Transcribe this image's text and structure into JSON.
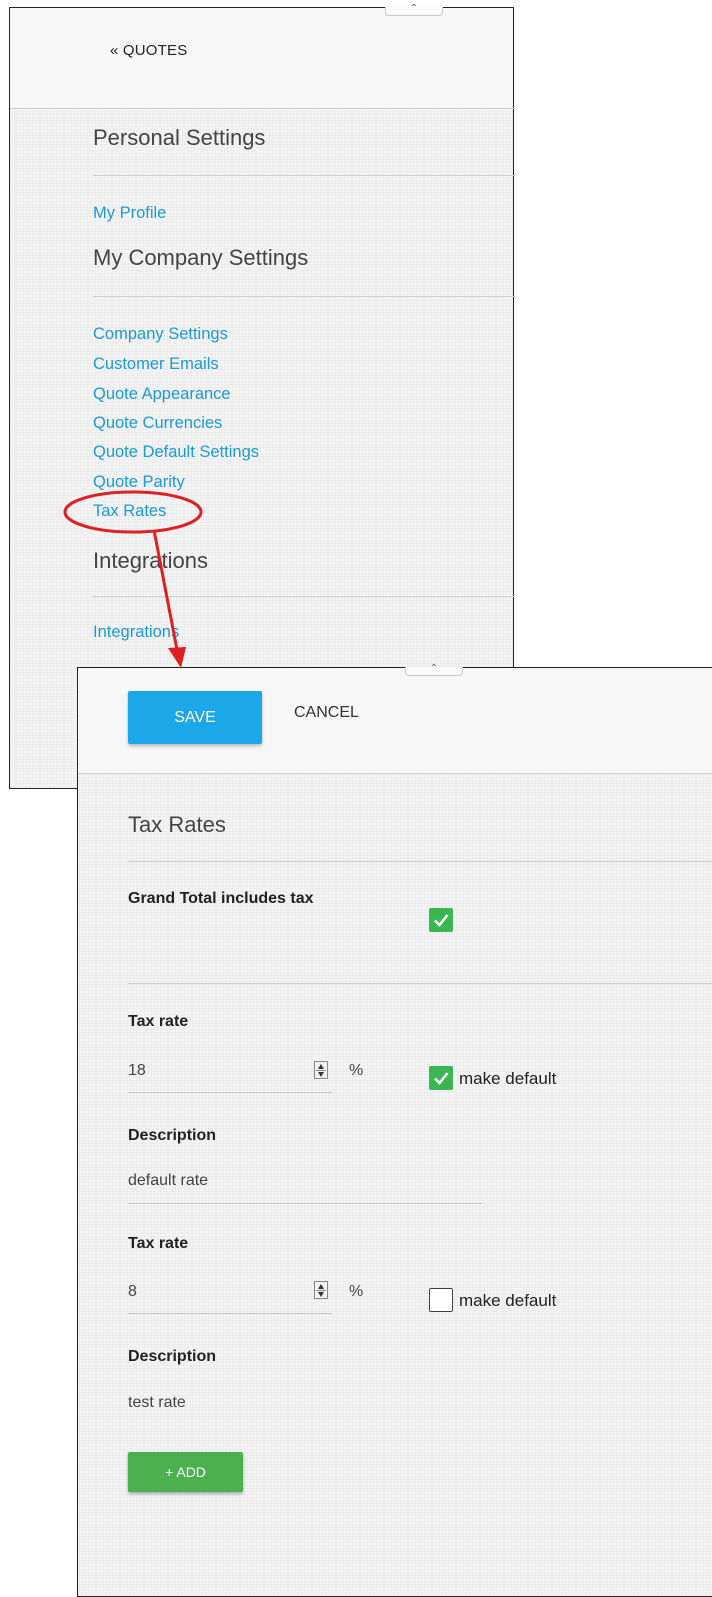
{
  "sidebar": {
    "back_link": "« QUOTES",
    "sections": [
      {
        "title": "Personal Settings",
        "links": [
          "My Profile"
        ]
      },
      {
        "title": "My Company Settings",
        "links": [
          "Company Settings",
          "Customer Emails",
          "Quote Appearance",
          "Quote Currencies",
          "Quote Default Settings",
          "Quote Parity",
          "Tax Rates"
        ]
      },
      {
        "title": "Integrations",
        "links": [
          "Integrations"
        ]
      }
    ]
  },
  "toolbar": {
    "save_label": "SAVE",
    "cancel_label": "CANCEL"
  },
  "tax_page": {
    "title": "Tax Rates",
    "grand_total_label": "Grand Total includes tax",
    "grand_total_checked": true,
    "rates": [
      {
        "rate_label": "Tax rate",
        "rate_value": "18",
        "unit": "%",
        "make_default_label": "make default",
        "is_default": true,
        "description_label": "Description",
        "description_value": "default rate"
      },
      {
        "rate_label": "Tax rate",
        "rate_value": "8",
        "unit": "%",
        "make_default_label": "make default",
        "is_default": false,
        "description_label": "Description",
        "description_value": "test rate"
      }
    ],
    "add_label": "+ ADD"
  },
  "colors": {
    "link": "#1a9ad6",
    "save_button": "#1ba7e8",
    "add_button": "#4caf50",
    "checkbox_checked": "#3cb554",
    "annotation": "#e02020"
  },
  "icons": [
    "collapse-tab-icon",
    "check-icon",
    "spinner-arrows-icon",
    "red-circle-annotation",
    "red-arrow-annotation"
  ]
}
